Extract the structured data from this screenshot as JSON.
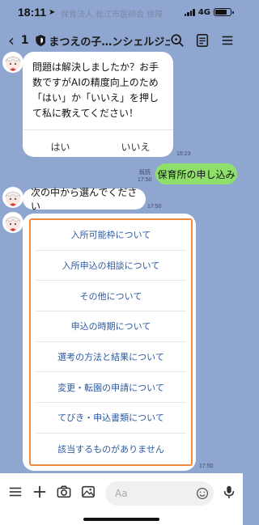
{
  "status": {
    "time": "18:11",
    "faded_text": "保育法人 松江市医師会 保障",
    "network": "4G"
  },
  "header": {
    "back_count": "1",
    "title": "まつえの子…ンシェルジュ"
  },
  "messages": {
    "question": "問題は解決しましたか？お手数ですがAIの精度向上のため「はい」か「いいえ」を押して私に教えてください！",
    "yes_label": "はい",
    "no_label": "いいえ",
    "question_time": "16:23",
    "user_read": "既読",
    "user_time": "17:50",
    "user_message": "保育所の申し込み",
    "prompt": "次の中から選んでください",
    "prompt_time": "17:50",
    "menu_time": "17:50",
    "menu_items": [
      "入所可能枠について",
      "入所申込の相談について",
      "その他について",
      "申込の時期について",
      "選考の方法と結果について",
      "変更・転園の申請について",
      "てびき・申込書類について",
      "該当するものがありません"
    ]
  },
  "input": {
    "placeholder": "Aa"
  },
  "colors": {
    "background": "#8fa6d0",
    "user_bubble": "#8fe06a",
    "menu_highlight": "#f08a3c",
    "menu_text": "#2c5aa0"
  }
}
